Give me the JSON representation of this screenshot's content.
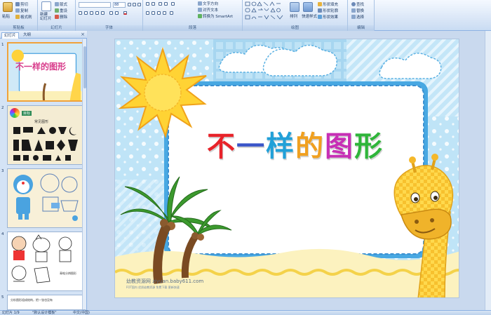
{
  "ribbon": {
    "clipboard": {
      "group": "剪贴板",
      "paste": "粘贴",
      "cut": "剪切",
      "copy": "复制",
      "format_painter": "格式刷"
    },
    "slides": {
      "group": "幻灯片",
      "new_slide": "新建\n幻灯片",
      "layout": "版式",
      "reset": "重设",
      "delete": "删除"
    },
    "font": {
      "group": "字体",
      "font_size": "88"
    },
    "paragraph": {
      "group": "段落",
      "text_direction": "文字方向",
      "align_text": "对齐文本",
      "smartart": "转换为 SmartArt"
    },
    "drawing": {
      "group": "绘图",
      "arrange": "排列",
      "quick_styles": "快速样式",
      "shape_fill": "形状填充",
      "shape_outline": "形状轮廓",
      "shape_effects": "形状效果"
    },
    "editing": {
      "group": "编辑",
      "find": "查找",
      "replace": "替换",
      "select": "选择"
    }
  },
  "pane": {
    "tab_slides": "幻灯片",
    "tab_outline": "大纲",
    "close": "×"
  },
  "thumbnails": [
    {
      "num": "1",
      "title": "不一样的图形"
    },
    {
      "num": "2",
      "title": "常见图形",
      "tag": "目标"
    },
    {
      "num": "3"
    },
    {
      "num": "4",
      "caption": "青蛙分辨图形"
    },
    {
      "num": "5",
      "caption": "分析图形组成结构，把一张也没有"
    }
  ],
  "slide": {
    "title_chars": [
      "不",
      "一",
      "样",
      "的",
      "图",
      "形"
    ],
    "title_colors": [
      "#e8232a",
      "#3a55c8",
      "#21a0d8",
      "#f0a020",
      "#c72fb5",
      "#2fb53a"
    ],
    "watermark": "幼教资源网 ziyuan.baby611.com",
    "watermark_small": "FOT国内  优质幼教资源  免费下载  更新快速"
  },
  "status": {
    "slide_info": "幻灯片 1/9",
    "theme": "\"默认设计模板\"",
    "language": "中文(中国)"
  }
}
